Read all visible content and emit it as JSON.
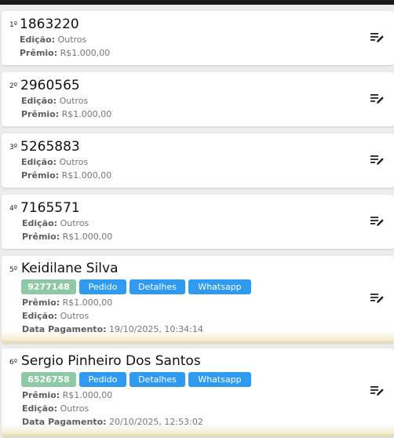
{
  "labels": {
    "edicao": "Edição:",
    "premio": "Prêmio:",
    "data_pagamento": "Data Pagamento:",
    "pedido": "Pedido",
    "detalhes": "Detalhes",
    "whatsapp": "Whatsapp"
  },
  "entries": [
    {
      "position": "1º",
      "title": "1863220",
      "edicao": "Outros",
      "premio": "R$1.000,00"
    },
    {
      "position": "2º",
      "title": "2960565",
      "edicao": "Outros",
      "premio": "R$1.000,00"
    },
    {
      "position": "3º",
      "title": "5265883",
      "edicao": "Outros",
      "premio": "R$1.000,00"
    },
    {
      "position": "4º",
      "title": "7165571",
      "edicao": "Outros",
      "premio": "R$1.000,00"
    },
    {
      "position": "5º",
      "title": "Keidilane Silva",
      "number": "9277148",
      "premio": "R$1.000,00",
      "edicao": "Outros",
      "data_pagamento": "19/10/2025, 10:34:14"
    },
    {
      "position": "6º",
      "title": "Sergio Pinheiro Dos Santos",
      "number": "6526758",
      "premio": "R$1.000,00",
      "edicao": "Outros",
      "data_pagamento": "20/10/2025, 12:53:02"
    }
  ],
  "colors": {
    "number_badge": "#8cc9a4",
    "button": "#2f9bf0",
    "winner_accent": "#eadfb5"
  },
  "icons": {
    "edit": "playlist-edit-icon"
  }
}
